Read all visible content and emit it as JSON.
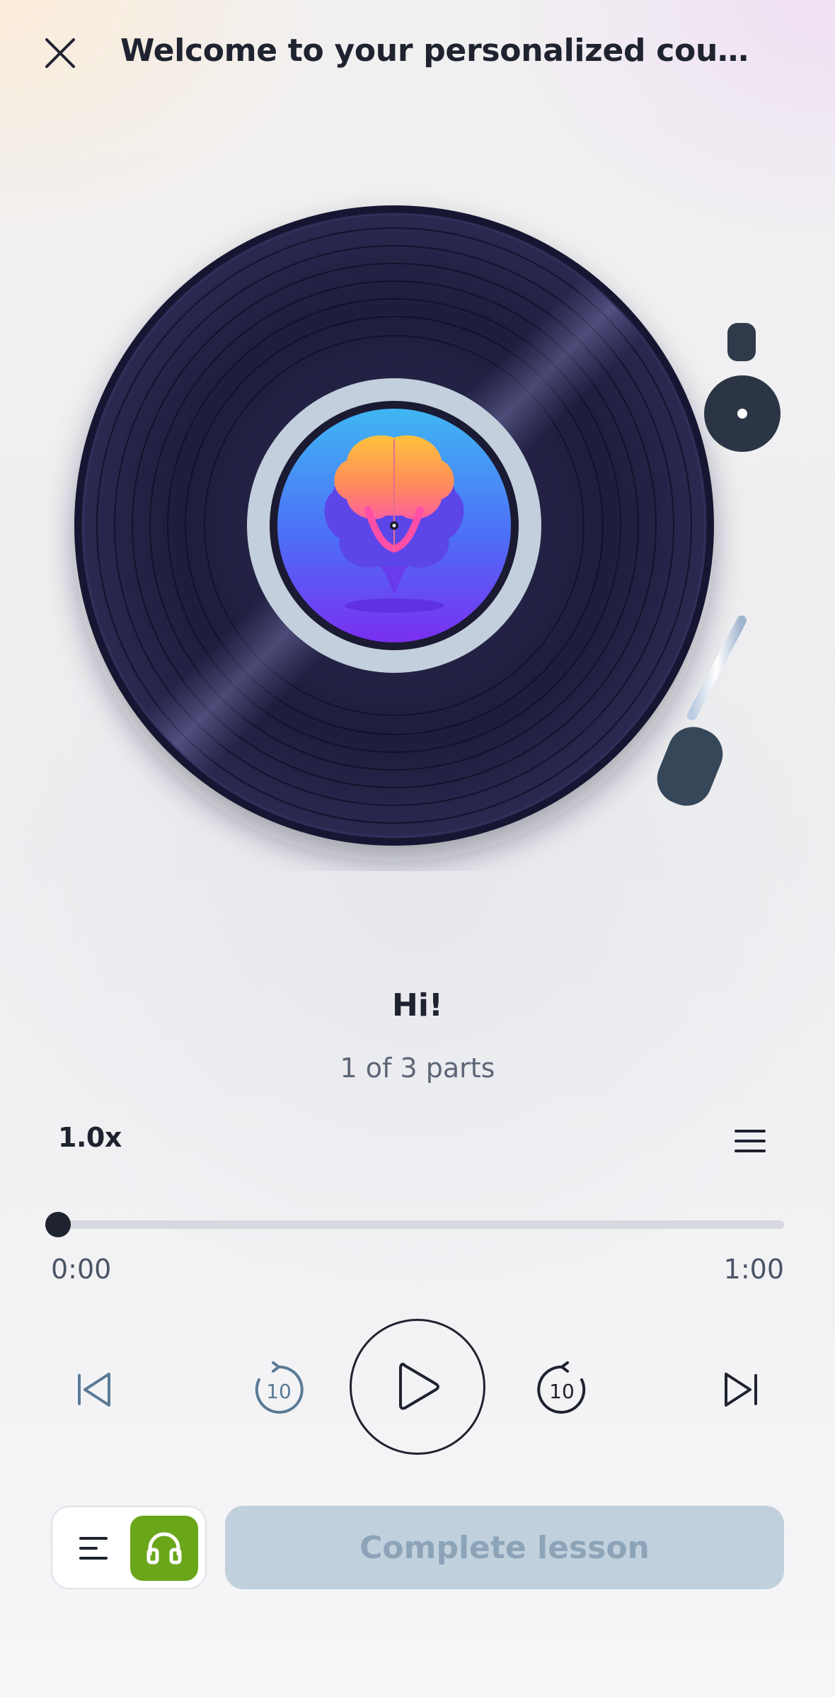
{
  "header": {
    "title": "Welcome to your personalized cours...",
    "close_icon": "close-icon"
  },
  "track": {
    "title": "Hi!",
    "parts": "1 of 3 parts"
  },
  "playback": {
    "speed": "1.0x",
    "current_time": "0:00",
    "total_time": "1:00",
    "progress_fraction": 0.0
  },
  "controls": {
    "previous_icon": "skip-previous-icon",
    "rewind_icon": "rewind-10-icon",
    "rewind_label": "10",
    "play_icon": "play-icon",
    "forward_icon": "forward-10-icon",
    "forward_label": "10",
    "next_icon": "skip-next-icon",
    "playlist_icon": "menu-icon"
  },
  "footer": {
    "text_mode_icon": "text-lines-icon",
    "audio_mode_icon": "headphones-icon",
    "complete_label": "Complete lesson"
  },
  "colors": {
    "accent_green": "#6aa61a",
    "button_disabled_bg": "#c1d0dd",
    "button_disabled_text": "#8da4b8",
    "record_dark": "#1c1c38",
    "label_blue": "#4a72f5"
  }
}
